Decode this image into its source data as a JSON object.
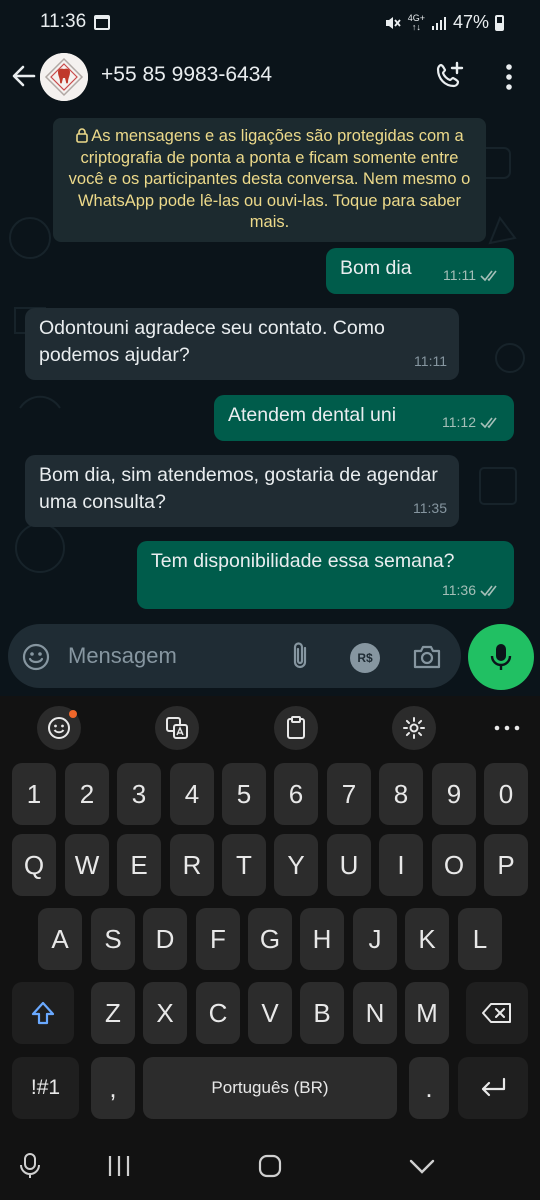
{
  "status_bar": {
    "time": "11:36",
    "network": "4G+",
    "battery": "47%"
  },
  "header": {
    "contact": "+55 85 9983-6434"
  },
  "encryption_notice": "As mensagens e as ligações são protegidas com a criptografia de ponta a ponta e ficam somente entre você e os participantes desta conversa. Nem mesmo o WhatsApp pode lê-las ou ouvi-las. Toque para saber mais.",
  "messages": [
    {
      "direction": "out",
      "text": "Bom dia",
      "time": "11:11",
      "status": "read"
    },
    {
      "direction": "in",
      "text": "Odontouni agradece seu contato. Como podemos ajudar?",
      "time": "11:11"
    },
    {
      "direction": "out",
      "text": "Atendem dental uni",
      "time": "11:12",
      "status": "read"
    },
    {
      "direction": "in",
      "text": "Bom dia, sim atendemos, gostaria de agendar uma consulta?",
      "time": "11:35"
    },
    {
      "direction": "out",
      "text": "Tem disponibilidade essa semana?",
      "time": "11:36",
      "status": "read"
    }
  ],
  "composer": {
    "placeholder": "Mensagem",
    "currency_label": "R$"
  },
  "keyboard": {
    "row_numbers": [
      "1",
      "2",
      "3",
      "4",
      "5",
      "6",
      "7",
      "8",
      "9",
      "0"
    ],
    "row_top": [
      "Q",
      "W",
      "E",
      "R",
      "T",
      "Y",
      "U",
      "I",
      "O",
      "P"
    ],
    "row_middle": [
      "A",
      "S",
      "D",
      "F",
      "G",
      "H",
      "J",
      "K",
      "L"
    ],
    "row_bottom": [
      "Z",
      "X",
      "C",
      "V",
      "B",
      "N",
      "M"
    ],
    "symbols_label": "!#1",
    "comma_label": ",",
    "space_label": "Português (BR)",
    "period_label": "."
  },
  "colors": {
    "background": "#0b141a",
    "outgoing_bubble": "#005c4b",
    "incoming_bubble": "#202c33",
    "notice_text": "#ecd98a",
    "accent_green": "#21c063",
    "read_ticks": "#a5bfb8"
  }
}
